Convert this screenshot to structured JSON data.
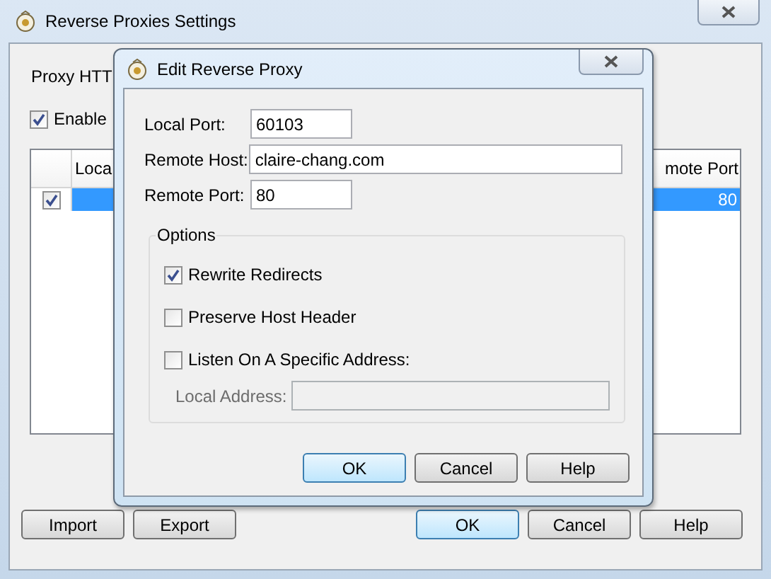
{
  "window": {
    "title": "Reverse Proxies Settings"
  },
  "description": "Proxy HTT",
  "enable_checkbox": {
    "label": "Enable",
    "checked": true
  },
  "table": {
    "columns": [
      "Loca",
      "mote Port"
    ],
    "rows": [
      {
        "checked": true,
        "selected": true,
        "remote_port": "80"
      }
    ]
  },
  "buttons": [
    {
      "label": "Import",
      "default": false
    },
    {
      "label": "Export",
      "default": false
    },
    {
      "label": "OK",
      "default": true
    },
    {
      "label": "Cancel",
      "default": false
    },
    {
      "label": "Help",
      "default": false
    }
  ],
  "dialog": {
    "title": "Edit Reverse Proxy",
    "fields": [
      {
        "label": "Local Port:",
        "value": "60103",
        "kind": "short"
      },
      {
        "label": "Remote Host:",
        "value": "claire-chang.com",
        "kind": "long"
      },
      {
        "label": "Remote Port:",
        "value": "80",
        "kind": "short"
      }
    ],
    "options": {
      "title": "Options",
      "items": [
        {
          "label": "Rewrite Redirects",
          "checked": true
        },
        {
          "label": "Preserve Host Header",
          "checked": false
        },
        {
          "label": "Listen On A Specific Address:",
          "checked": false
        }
      ],
      "local_address": {
        "label": "Local Address:",
        "disabled": true
      }
    },
    "buttons": [
      {
        "label": "OK",
        "default": true
      },
      {
        "label": "Cancel",
        "default": false
      },
      {
        "label": "Help",
        "default": false
      }
    ]
  }
}
